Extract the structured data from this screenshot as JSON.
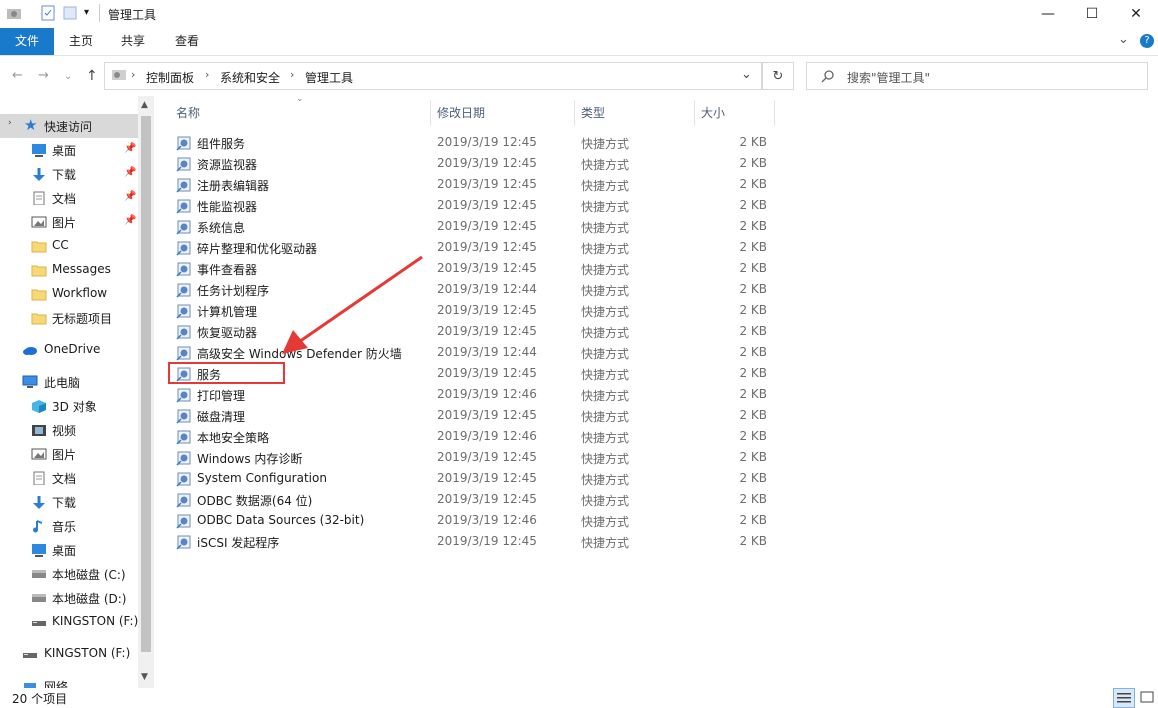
{
  "window": {
    "title": "管理工具",
    "minimize_glyph": "—",
    "maximize_glyph": "☐",
    "close_glyph": "✕"
  },
  "ribbon": {
    "tabs": [
      "文件",
      "主页",
      "共享",
      "查看"
    ],
    "expand_glyph": "⌄",
    "help_glyph": "?"
  },
  "nav": {
    "back": "←",
    "forward": "→",
    "recent": "⌄",
    "up": "↑",
    "breadcrumb": [
      "控制面板",
      "系统和安全",
      "管理工具"
    ],
    "separator": "›",
    "dropdown_glyph": "⌄",
    "refresh_glyph": "↻"
  },
  "search": {
    "placeholder": "搜索\"管理工具\""
  },
  "sidebar": {
    "quick_access": "快速访问",
    "items": [
      {
        "label": "桌面",
        "icon": "desktop-icon",
        "pinned": true
      },
      {
        "label": "下载",
        "icon": "download-icon",
        "pinned": true
      },
      {
        "label": "文档",
        "icon": "document-icon",
        "pinned": true
      },
      {
        "label": "图片",
        "icon": "picture-icon",
        "pinned": true
      },
      {
        "label": "CC",
        "icon": "folder-icon",
        "pinned": false
      },
      {
        "label": "Messages",
        "icon": "folder-icon",
        "pinned": false
      },
      {
        "label": "Workflow",
        "icon": "folder-icon",
        "pinned": false
      },
      {
        "label": "无标题项目",
        "icon": "folder-icon",
        "pinned": false
      }
    ],
    "onedrive": "OneDrive",
    "this_pc": "此电脑",
    "pc_items": [
      {
        "label": "3D 对象",
        "icon": "3d-objects-icon"
      },
      {
        "label": "视频",
        "icon": "video-icon"
      },
      {
        "label": "图片",
        "icon": "picture-icon"
      },
      {
        "label": "文档",
        "icon": "document-icon"
      },
      {
        "label": "下载",
        "icon": "download-icon"
      },
      {
        "label": "音乐",
        "icon": "music-icon"
      },
      {
        "label": "桌面",
        "icon": "desktop-icon"
      },
      {
        "label": "本地磁盘 (C:)",
        "icon": "drive-icon"
      },
      {
        "label": "本地磁盘 (D:)",
        "icon": "drive-icon"
      },
      {
        "label": "KINGSTON (F:)",
        "icon": "usb-drive-icon"
      }
    ],
    "kingston_root": "KINGSTON (F:)",
    "network": "网络"
  },
  "columns": {
    "name": "名称",
    "date": "修改日期",
    "type": "类型",
    "size": "大小"
  },
  "files": [
    {
      "name": "组件服务",
      "date": "2019/3/19 12:45",
      "type": "快捷方式",
      "size": "2 KB"
    },
    {
      "name": "资源监视器",
      "date": "2019/3/19 12:45",
      "type": "快捷方式",
      "size": "2 KB"
    },
    {
      "name": "注册表编辑器",
      "date": "2019/3/19 12:45",
      "type": "快捷方式",
      "size": "2 KB"
    },
    {
      "name": "性能监视器",
      "date": "2019/3/19 12:45",
      "type": "快捷方式",
      "size": "2 KB"
    },
    {
      "name": "系统信息",
      "date": "2019/3/19 12:45",
      "type": "快捷方式",
      "size": "2 KB"
    },
    {
      "name": "碎片整理和优化驱动器",
      "date": "2019/3/19 12:45",
      "type": "快捷方式",
      "size": "2 KB"
    },
    {
      "name": "事件查看器",
      "date": "2019/3/19 12:45",
      "type": "快捷方式",
      "size": "2 KB"
    },
    {
      "name": "任务计划程序",
      "date": "2019/3/19 12:44",
      "type": "快捷方式",
      "size": "2 KB"
    },
    {
      "name": "计算机管理",
      "date": "2019/3/19 12:45",
      "type": "快捷方式",
      "size": "2 KB"
    },
    {
      "name": "恢复驱动器",
      "date": "2019/3/19 12:45",
      "type": "快捷方式",
      "size": "2 KB"
    },
    {
      "name": "高级安全 Windows Defender 防火墙",
      "date": "2019/3/19 12:44",
      "type": "快捷方式",
      "size": "2 KB"
    },
    {
      "name": "服务",
      "date": "2019/3/19 12:45",
      "type": "快捷方式",
      "size": "2 KB"
    },
    {
      "name": "打印管理",
      "date": "2019/3/19 12:46",
      "type": "快捷方式",
      "size": "2 KB"
    },
    {
      "name": "磁盘清理",
      "date": "2019/3/19 12:45",
      "type": "快捷方式",
      "size": "2 KB"
    },
    {
      "name": "本地安全策略",
      "date": "2019/3/19 12:46",
      "type": "快捷方式",
      "size": "2 KB"
    },
    {
      "name": "Windows 内存诊断",
      "date": "2019/3/19 12:45",
      "type": "快捷方式",
      "size": "2 KB"
    },
    {
      "name": "System Configuration",
      "date": "2019/3/19 12:45",
      "type": "快捷方式",
      "size": "2 KB"
    },
    {
      "name": "ODBC 数据源(64 位)",
      "date": "2019/3/19 12:45",
      "type": "快捷方式",
      "size": "2 KB"
    },
    {
      "name": "ODBC Data Sources (32-bit)",
      "date": "2019/3/19 12:46",
      "type": "快捷方式",
      "size": "2 KB"
    },
    {
      "name": "iSCSI 发起程序",
      "date": "2019/3/19 12:45",
      "type": "快捷方式",
      "size": "2 KB"
    }
  ],
  "status": {
    "count": "20 个项目"
  },
  "colors": {
    "accent": "#1979ca",
    "annotation": "#e53935"
  }
}
